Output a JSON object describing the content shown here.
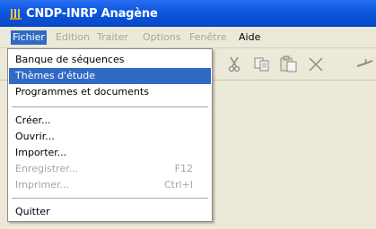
{
  "window": {
    "title": "CNDP-INRP Anagène"
  },
  "menubar": {
    "items": [
      {
        "label": "Fichier",
        "state": "active"
      },
      {
        "label": "Edition",
        "state": "disabled"
      },
      {
        "label": "Traiter",
        "state": "disabled"
      },
      {
        "label": "Options",
        "state": "disabled"
      },
      {
        "label": "Fenêtre",
        "state": "disabled"
      },
      {
        "label": "Aide",
        "state": "enabled"
      }
    ]
  },
  "toolbar": {
    "icons": [
      "cut-icon",
      "copy-icon",
      "paste-icon",
      "delete-icon",
      "tool-icon"
    ]
  },
  "file_menu": {
    "items": [
      {
        "label": "Banque de séquences",
        "shortcut": "",
        "state": "enabled"
      },
      {
        "label": "Thèmes d'étude",
        "shortcut": "",
        "state": "highlighted"
      },
      {
        "label": "Programmes et documents",
        "shortcut": "",
        "state": "enabled"
      },
      {
        "label": "Créer...",
        "shortcut": "",
        "state": "enabled"
      },
      {
        "label": "Ouvrir...",
        "shortcut": "",
        "state": "enabled"
      },
      {
        "label": "Importer...",
        "shortcut": "",
        "state": "enabled"
      },
      {
        "label": "Enregistrer...",
        "shortcut": "F12",
        "state": "disabled"
      },
      {
        "label": "Imprimer...",
        "shortcut": "Ctrl+I",
        "state": "disabled"
      },
      {
        "label": "Quitter",
        "shortcut": "",
        "state": "enabled"
      }
    ]
  },
  "colors": {
    "title_bar": "#0c58e0",
    "highlight": "#316ac5",
    "disabled_text": "#a7a69a",
    "background": "#ece9d8"
  }
}
